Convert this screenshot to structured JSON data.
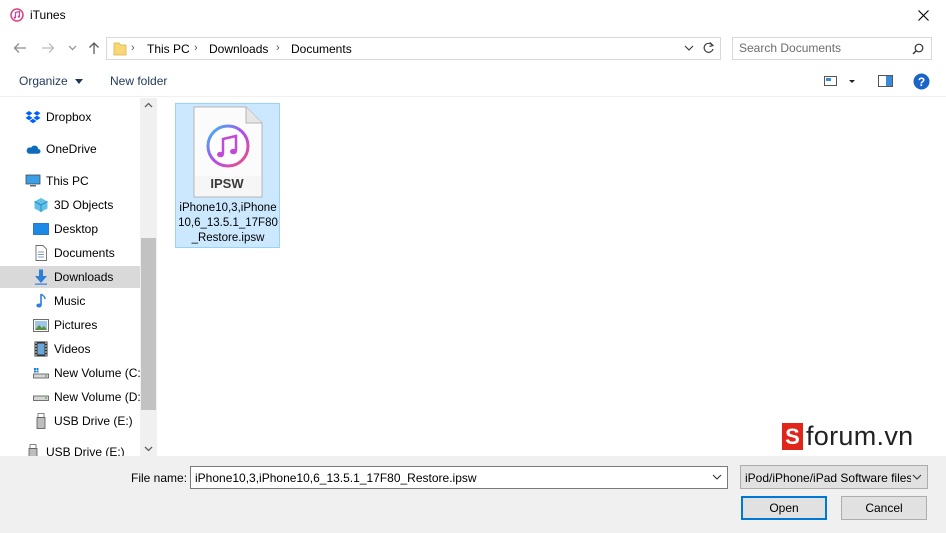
{
  "window": {
    "title": "iTunes",
    "app_icon": "itunes-icon",
    "close_icon": "close-icon"
  },
  "address": {
    "back_icon": "arrow-left-icon",
    "forward_icon": "arrow-right-icon",
    "recent_icon": "chevron-down-icon",
    "up_icon": "arrow-up-icon",
    "crumbs": [
      "This PC",
      "Downloads",
      "Documents"
    ],
    "refresh_icon": "refresh-icon"
  },
  "search": {
    "placeholder": "Search Documents"
  },
  "toolbar": {
    "organize_label": "Organize",
    "new_folder_label": "New folder",
    "view_icon": "view-options-icon",
    "preview_icon": "preview-pane-icon",
    "help_icon": "help-icon"
  },
  "sidebar": {
    "items": [
      {
        "label": "Dropbox",
        "icon": "dropbox-icon"
      },
      {
        "label": "OneDrive",
        "icon": "onedrive-icon"
      },
      {
        "label": "This PC",
        "icon": "this-pc-icon"
      },
      {
        "label": "3D Objects",
        "icon": "3d-objects-icon"
      },
      {
        "label": "Desktop",
        "icon": "desktop-icon"
      },
      {
        "label": "Documents",
        "icon": "documents-icon"
      },
      {
        "label": "Downloads",
        "icon": "downloads-icon"
      },
      {
        "label": "Music",
        "icon": "music-icon"
      },
      {
        "label": "Pictures",
        "icon": "pictures-icon"
      },
      {
        "label": "Videos",
        "icon": "videos-icon"
      },
      {
        "label": "New Volume (C:",
        "icon": "drive-c-icon"
      },
      {
        "label": "New Volume (D:",
        "icon": "drive-d-icon"
      },
      {
        "label": "USB Drive (E:)",
        "icon": "usb-drive-icon"
      },
      {
        "label": "USB Drive (E:)",
        "icon": "usb-drive-icon"
      }
    ],
    "selected": "Downloads"
  },
  "files": [
    {
      "name": "iPhone10,3,iPhone10,6_13.5.1_17F80_Restore.ipsw",
      "badge": "IPSW",
      "icon": "ipsw-file-icon"
    }
  ],
  "watermark": {
    "logo_letter": "S",
    "text": "forum.vn"
  },
  "footer": {
    "file_name_label": "File name:",
    "file_name_value": "iPhone10,3,iPhone10,6_13.5.1_17F80_Restore.ipsw",
    "file_type": "iPod/iPhone/iPad Software files",
    "open_label": "Open",
    "cancel_label": "Cancel"
  },
  "colors": {
    "selection": "#cce8ff",
    "selection_border": "#99d1ff",
    "accent": "#0078d7",
    "watermark_red": "#e0251b"
  }
}
